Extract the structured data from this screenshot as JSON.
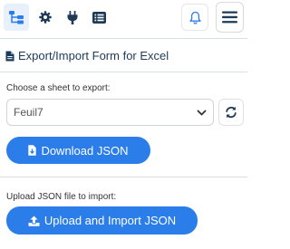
{
  "toolbar": {
    "icons": [
      "sitemap-icon",
      "gear-icon",
      "plug-icon",
      "list-icon",
      "bell-icon",
      "hamburger-menu-icon"
    ]
  },
  "main": {
    "title": "Export/Import Form for Excel",
    "export_label": "Choose a sheet to export:",
    "sheet_select": {
      "value": "Feuil7"
    },
    "download_button": "Download JSON",
    "import_label": "Upload JSON file to import:",
    "upload_button": "Upload and Import JSON"
  },
  "colors": {
    "accent": "#2b7de9",
    "title_text": "#1b3b5c",
    "icon_dark": "#1f3a56"
  }
}
